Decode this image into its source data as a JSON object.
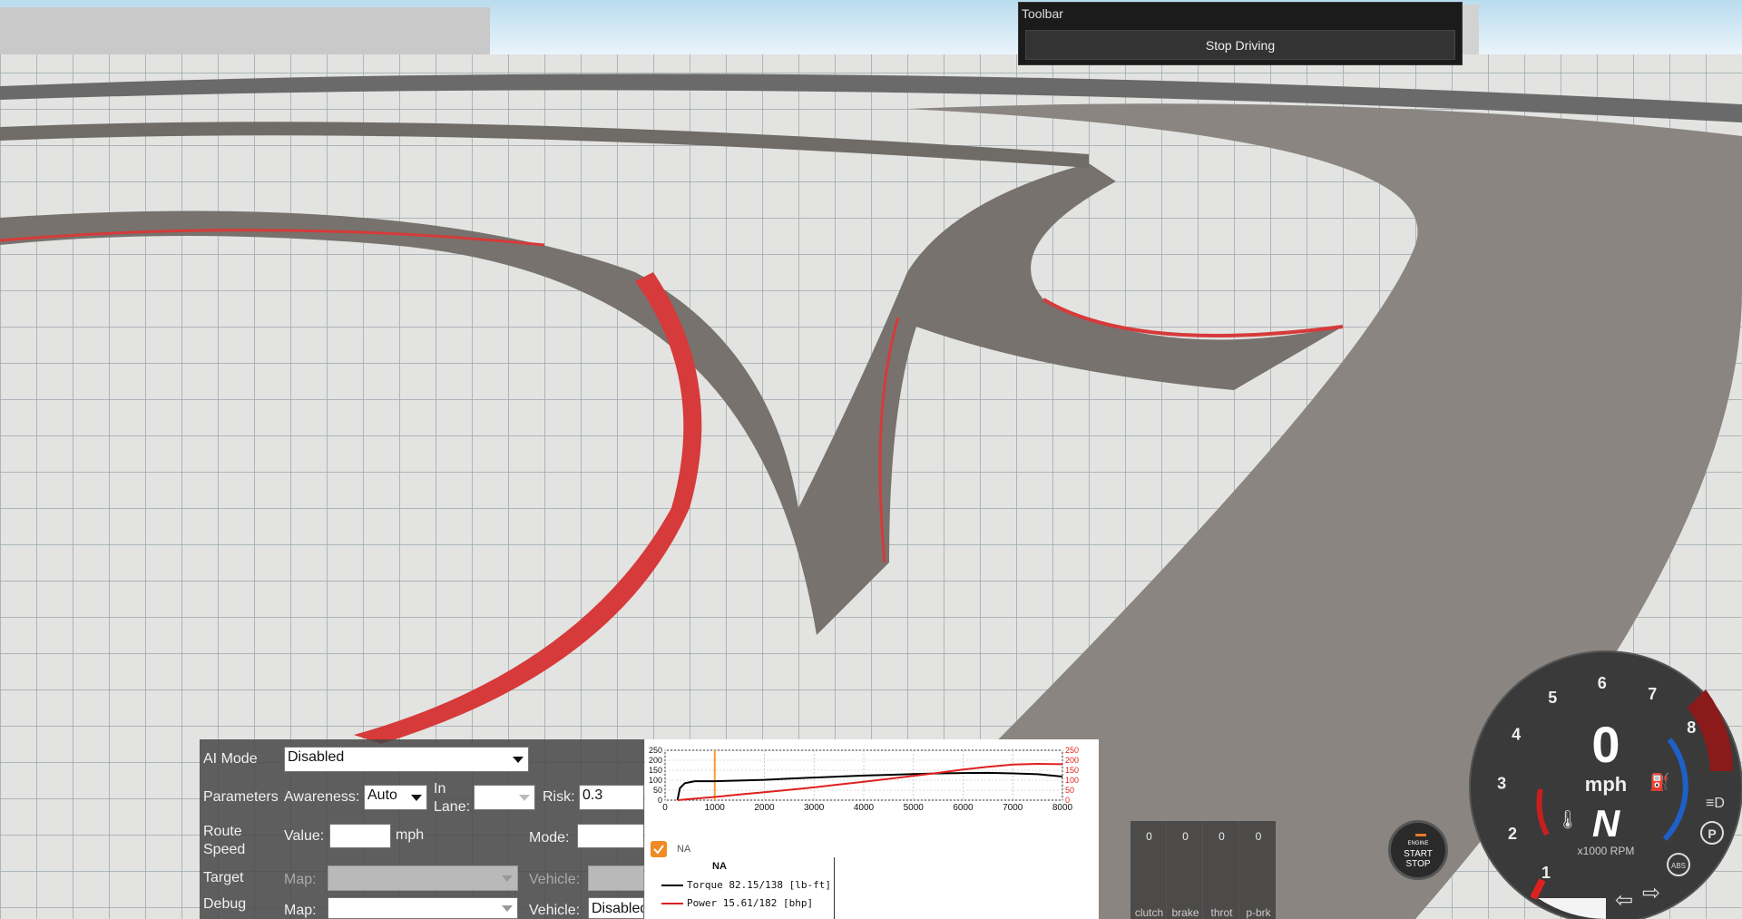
{
  "toolbar": {
    "title": "Toolbar",
    "stop_driving_label": "Stop Driving"
  },
  "ai": {
    "mode_label": "AI Mode",
    "mode_value": "Disabled",
    "parameters_label": "Parameters",
    "awareness_label": "Awareness:",
    "awareness_value": "Auto",
    "in_lane_label": "In Lane:",
    "in_lane_value": "",
    "risk_label": "Risk:",
    "risk_value": "0.3",
    "route_speed_label": "Route Speed",
    "value_label": "Value:",
    "value_value": "",
    "value_unit": "mph",
    "mode2_label": "Mode:",
    "mode2_value": "",
    "target_label": "Target",
    "target_map_label": "Map:",
    "target_map_value": "",
    "target_vehicle_label": "Vehicle:",
    "target_vehicle_value": "",
    "debug_label": "Debug",
    "debug_map_label": "Map:",
    "debug_map_value": "",
    "debug_vehicle_label": "Vehicle:",
    "debug_vehicle_value": "Disabled"
  },
  "chart_data": {
    "type": "line",
    "title": "NA",
    "checkbox_label": "NA",
    "xlim": [
      0,
      8000
    ],
    "ylim": [
      0,
      250
    ],
    "x_ticks": [
      0,
      1000,
      2000,
      3000,
      4000,
      5000,
      6000,
      7000,
      8000
    ],
    "y_ticks": [
      0,
      50,
      100,
      150,
      200,
      250
    ],
    "y2_ticks": [
      0,
      50,
      100,
      150,
      200,
      250
    ],
    "marker_rpm": 1000,
    "series": [
      {
        "name": "Torque",
        "color": "#000000",
        "legend": "Torque 82.15/138 [lb-ft]",
        "points": [
          [
            250,
            0
          ],
          [
            300,
            60
          ],
          [
            400,
            85
          ],
          [
            600,
            95
          ],
          [
            1000,
            95
          ],
          [
            1500,
            98
          ],
          [
            2000,
            102
          ],
          [
            2500,
            108
          ],
          [
            3000,
            113
          ],
          [
            3500,
            118
          ],
          [
            4000,
            123
          ],
          [
            4500,
            127
          ],
          [
            5000,
            131
          ],
          [
            5500,
            134
          ],
          [
            6000,
            136
          ],
          [
            6500,
            137
          ],
          [
            7000,
            134
          ],
          [
            7500,
            130
          ],
          [
            8000,
            118
          ]
        ]
      },
      {
        "name": "Power",
        "color": "#e02020",
        "legend": "Power 15.61/182 [bhp]",
        "points": [
          [
            250,
            0
          ],
          [
            500,
            6
          ],
          [
            1000,
            16
          ],
          [
            1500,
            28
          ],
          [
            2000,
            40
          ],
          [
            2500,
            52
          ],
          [
            3000,
            64
          ],
          [
            3500,
            78
          ],
          [
            4000,
            92
          ],
          [
            4500,
            107
          ],
          [
            5000,
            122
          ],
          [
            5500,
            137
          ],
          [
            6000,
            153
          ],
          [
            6500,
            167
          ],
          [
            7000,
            178
          ],
          [
            7500,
            182
          ],
          [
            8000,
            180
          ]
        ]
      }
    ]
  },
  "pedals": [
    {
      "name": "clutch",
      "value": "0"
    },
    {
      "name": "brake",
      "value": "0"
    },
    {
      "name": "throt",
      "value": "0"
    },
    {
      "name": "p-brk",
      "value": "0"
    }
  ],
  "engine_button": {
    "top": "ENGINE",
    "line1": "START",
    "line2": "STOP",
    "indicator_color": "#e8792a"
  },
  "gauge": {
    "speed": "0",
    "unit": "mph",
    "gear": "N",
    "rpm_label": "x1000 RPM",
    "rpm_ticks": [
      "1",
      "2",
      "3",
      "4",
      "5",
      "6",
      "7",
      "8"
    ],
    "abs_label": "ABS",
    "parking_label": "P",
    "icons": [
      "temperature-icon",
      "fuel-icon",
      "headlight-icon",
      "parking-brake-icon",
      "abs-icon",
      "left-turn-signal-icon",
      "right-turn-signal-icon"
    ]
  }
}
